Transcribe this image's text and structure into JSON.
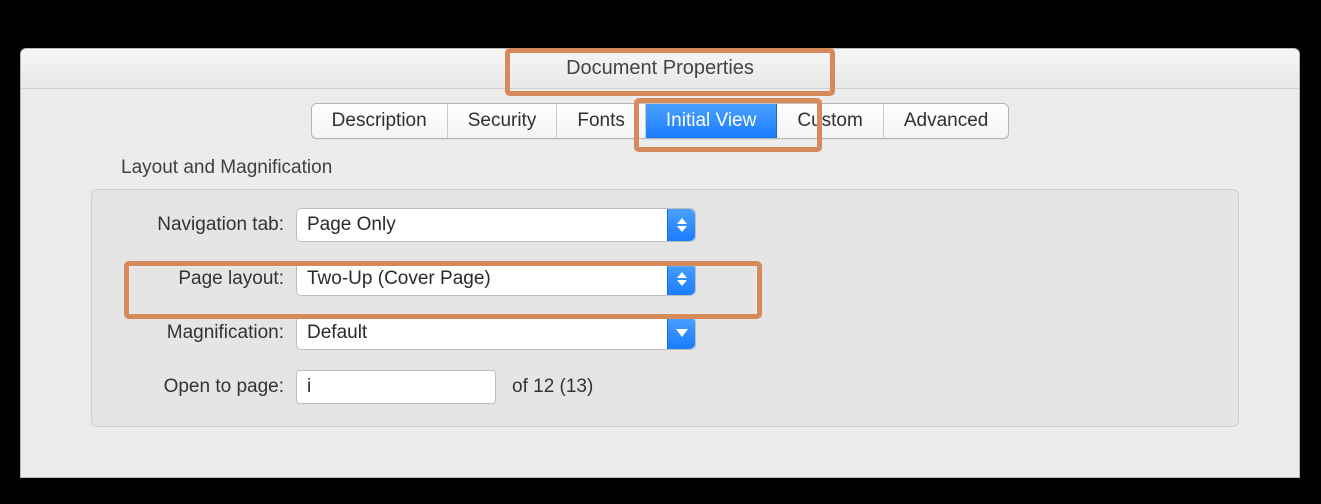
{
  "window": {
    "title": "Document Properties"
  },
  "tabs": {
    "description": "Description",
    "security": "Security",
    "fonts": "Fonts",
    "initial_view": "Initial View",
    "custom": "Custom",
    "advanced": "Advanced"
  },
  "section": {
    "title": "Layout and Magnification"
  },
  "form": {
    "navigation_tab": {
      "label": "Navigation tab:",
      "value": "Page Only"
    },
    "page_layout": {
      "label": "Page layout:",
      "value": "Two-Up (Cover Page)"
    },
    "magnification": {
      "label": "Magnification:",
      "value": "Default"
    },
    "open_to_page": {
      "label": "Open to page:",
      "value": "i",
      "suffix": "of 12 (13)"
    }
  }
}
